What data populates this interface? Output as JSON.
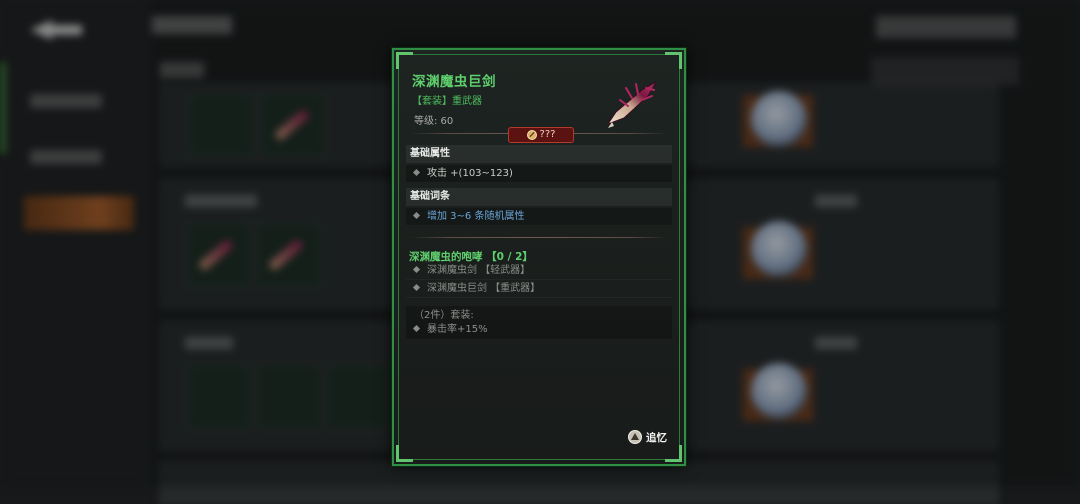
{
  "item": {
    "name": "深渊魔虫巨剑",
    "type": "【套装】重武器",
    "level": "等级:  60",
    "gem_label": "???",
    "icon": "greatsword-icon"
  },
  "base_attributes": {
    "title": "基础属性",
    "attack": "攻击 +(103~123)"
  },
  "base_affix": {
    "title": "基础词条",
    "affix": "增加 3~6 条随机属性"
  },
  "set": {
    "title": "深渊魔虫的咆哮 【0 / 2】",
    "pieces": [
      "深渊魔虫剑 【轻武器】",
      "深渊魔虫巨剑 【重武器】"
    ],
    "bonus_title": "（2件）套装:",
    "bonus": "暴击率+15%"
  },
  "footer": {
    "recall_label": "追忆",
    "recall_icon": "triangle-emblem-icon"
  },
  "colors": {
    "border": "#2f8f45",
    "item_name": "#5fd06d",
    "affix_blue": "#6aa4d8",
    "gem_badge": "#5a1310"
  }
}
